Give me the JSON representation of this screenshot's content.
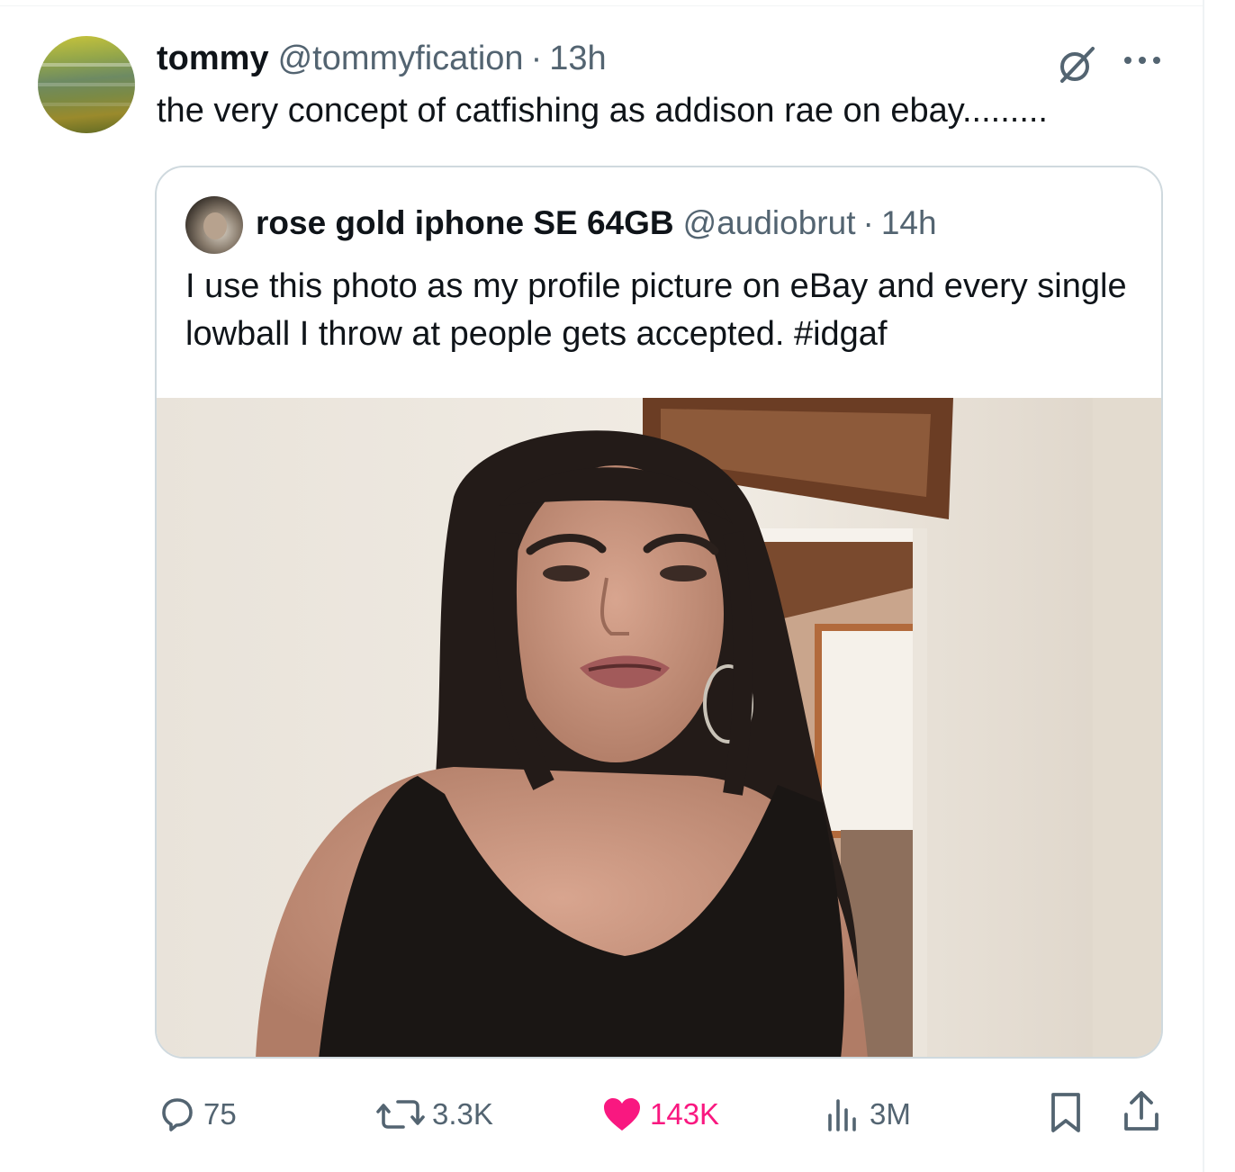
{
  "tweet": {
    "author": {
      "display_name": "tommy",
      "handle": "@tommyfication",
      "separator": "·",
      "time": "13h"
    },
    "text": "the very concept of catfishing as addison rae on ebay.........",
    "icons": {
      "grok": "grok-icon",
      "more": "more-options-icon"
    }
  },
  "quote": {
    "author": {
      "display_name": "rose gold iphone SE 64GB",
      "handle": "@audiobrut",
      "separator": "·",
      "time": "14h"
    },
    "text": "I use this photo as my profile picture on eBay and every single lowball I throw at people gets accepted. #idgaf",
    "media": {
      "type": "photo"
    }
  },
  "actions": {
    "replies": {
      "icon": "reply-icon",
      "count": "75"
    },
    "reposts": {
      "icon": "repost-icon",
      "count": "3.3K"
    },
    "likes": {
      "icon": "heart-icon",
      "count": "143K",
      "liked": true,
      "color": "#f91880"
    },
    "views": {
      "icon": "views-icon",
      "count": "3M"
    },
    "bookmark": {
      "icon": "bookmark-icon"
    },
    "share": {
      "icon": "share-icon"
    }
  },
  "colors": {
    "text": "#0f1419",
    "secondary": "#536471",
    "border": "#cfd9de",
    "like": "#f91880"
  }
}
